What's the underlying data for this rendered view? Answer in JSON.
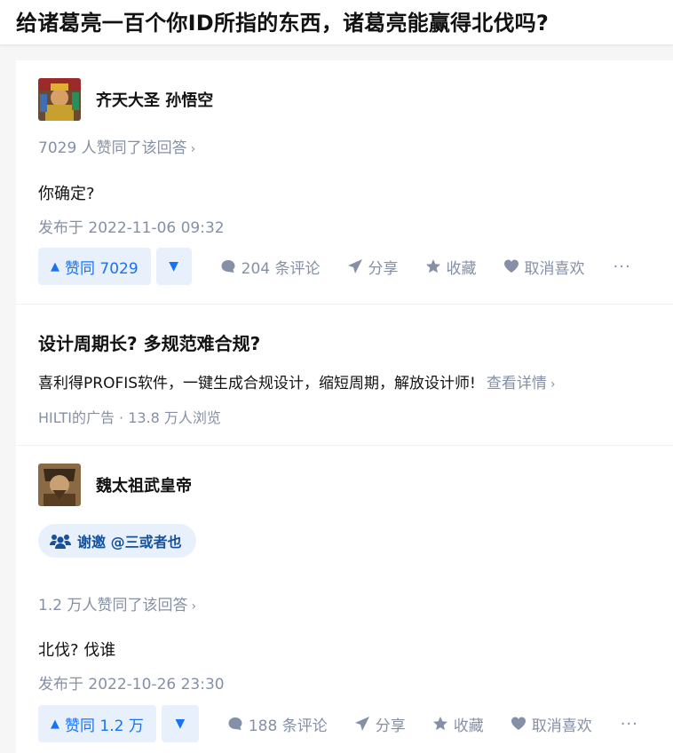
{
  "question": {
    "title": "给诸葛亮一百个你ID所指的东西，诸葛亮能赢得北伐吗?"
  },
  "answers": [
    {
      "author": "齐天大圣 孙悟空",
      "votes_text": "7029 人赞同了该回答",
      "content": "你确定?",
      "published": "发布于 2022-11-06 09:32",
      "actions": {
        "upvote": "赞同 7029",
        "comments": "204 条评论",
        "share": "分享",
        "collect": "收藏",
        "unlike": "取消喜欢",
        "more": "···"
      }
    },
    {
      "author": "魏太祖武皇帝",
      "invite": "谢邀 @三或者也",
      "votes_text": "1.2 万人赞同了该回答",
      "content": "北伐? 伐谁",
      "published": "发布于 2022-10-26 23:30",
      "actions": {
        "upvote": "赞同 1.2 万",
        "comments": "188 条评论",
        "share": "分享",
        "collect": "收藏",
        "unlike": "取消喜欢",
        "more": "···"
      }
    }
  ],
  "ad": {
    "title": "设计周期长? 多规范难合规?",
    "body": "喜利得PROFIS软件，一键生成合规设计，缩短周期，解放设计师!",
    "link": "查看详情",
    "meta": "HILTI的广告 · 13.8 万人浏览"
  },
  "colors": {
    "accent_blue": "#1772f6",
    "vote_bg": "#e8f0fc",
    "muted_gray": "#8590a6",
    "invite_text": "#175199"
  },
  "icons": [
    "chevron-right-icon",
    "upvote-triangle-icon",
    "downvote-triangle-icon",
    "comment-icon",
    "share-icon",
    "star-icon",
    "heart-icon",
    "invite-people-icon"
  ]
}
